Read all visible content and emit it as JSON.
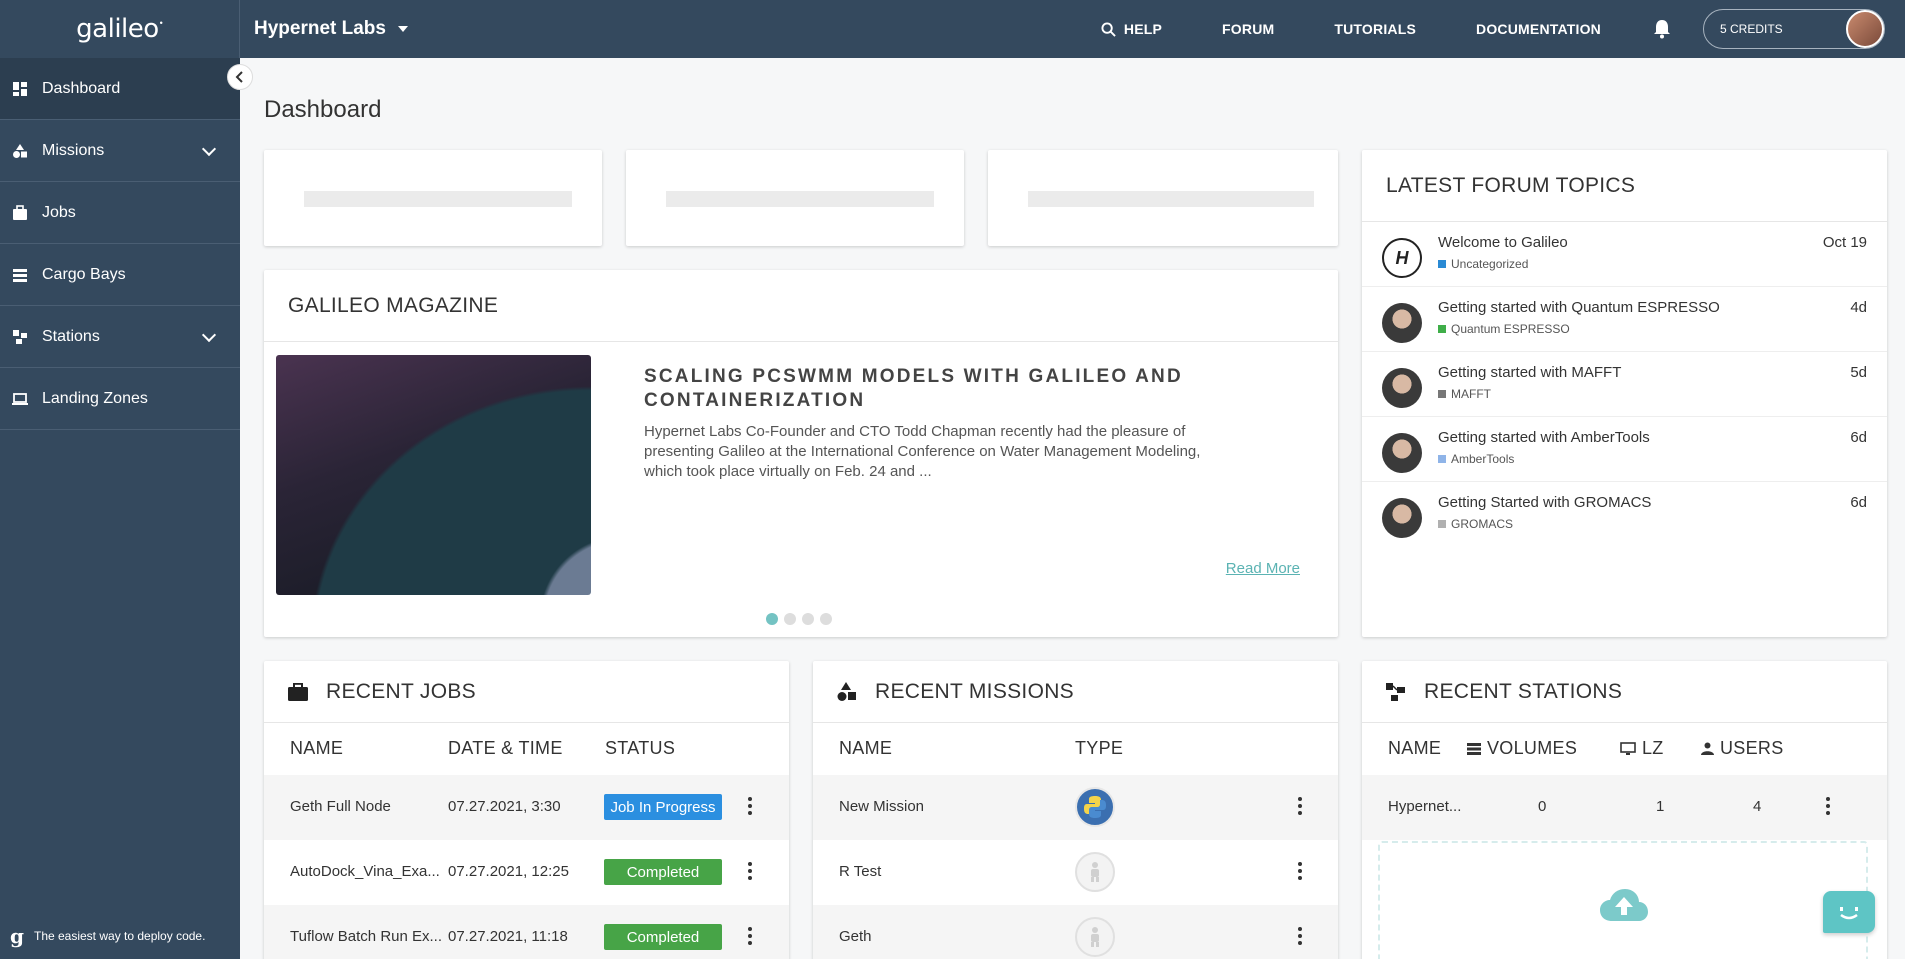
{
  "brand": {
    "logo": "galileo",
    "org_name": "Hypernet Labs"
  },
  "topnav": {
    "help": "HELP",
    "forum": "FORUM",
    "tutorials": "TUTORIALS",
    "documentation": "DOCUMENTATION",
    "credits": "5 CREDITS"
  },
  "sidebar": {
    "items": [
      {
        "label": "Dashboard",
        "icon": "dashboard-icon"
      },
      {
        "label": "Missions",
        "icon": "missions-icon"
      },
      {
        "label": "Jobs",
        "icon": "briefcase-icon"
      },
      {
        "label": "Cargo Bays",
        "icon": "list-icon"
      },
      {
        "label": "Stations",
        "icon": "stations-icon"
      },
      {
        "label": "Landing Zones",
        "icon": "laptop-icon"
      }
    ],
    "footer_text": "The easiest way to deploy code."
  },
  "page": {
    "title": "Dashboard"
  },
  "magazine": {
    "heading": "GALILEO MAGAZINE",
    "article_title": "SCALING PCSWMM MODELS WITH GALILEO AND CONTAINERIZATION",
    "article_text": "Hypernet Labs Co-Founder and CTO Todd Chapman recently had the pleasure of presenting Galileo at the International Conference on Water Management Modeling, which took place virtually on Feb. 24 and ...",
    "read_more": "Read More"
  },
  "forum": {
    "heading": "LATEST FORUM TOPICS",
    "topics": [
      {
        "title": "Welcome to Galileo",
        "category": "Uncategorized",
        "color": "#2a8ad4",
        "date": "Oct 19"
      },
      {
        "title": "Getting started with Quantum ESPRESSO",
        "category": "Quantum ESPRESSO",
        "color": "#3fae49",
        "date": "4d"
      },
      {
        "title": "Getting started with MAFFT",
        "category": "MAFFT",
        "color": "#777777",
        "date": "5d"
      },
      {
        "title": "Getting started with AmberTools",
        "category": "AmberTools",
        "color": "#8fb4e8",
        "date": "6d"
      },
      {
        "title": "Getting Started with GROMACS",
        "category": "GROMACS",
        "color": "#b0b0b0",
        "date": "6d"
      }
    ]
  },
  "jobs": {
    "heading": "RECENT JOBS",
    "columns": {
      "name": "NAME",
      "datetime": "DATE & TIME",
      "status": "STATUS"
    },
    "rows": [
      {
        "name": "Geth Full Node",
        "datetime": "07.27.2021, 3:30",
        "status": "Job In Progress"
      },
      {
        "name": "AutoDock_Vina_Exa...",
        "datetime": "07.27.2021, 12:25",
        "status": "Completed"
      },
      {
        "name": "Tuflow Batch Run Ex...",
        "datetime": "07.27.2021, 11:18",
        "status": "Completed"
      }
    ]
  },
  "missions": {
    "heading": "RECENT MISSIONS",
    "columns": {
      "name": "NAME",
      "type": "TYPE"
    },
    "rows": [
      {
        "name": "New Mission",
        "type_icon": "python-icon"
      },
      {
        "name": "R Test",
        "type_icon": "generic-runner-icon"
      },
      {
        "name": "Geth",
        "type_icon": "generic-runner-icon"
      }
    ]
  },
  "stations": {
    "heading": "RECENT STATIONS",
    "columns": {
      "name": "NAME",
      "volumes": "VOLUMES",
      "lz": "LZ",
      "users": "USERS"
    },
    "rows": [
      {
        "name": "Hypernet...",
        "volumes": "0",
        "lz": "1",
        "users": "4"
      }
    ]
  }
}
